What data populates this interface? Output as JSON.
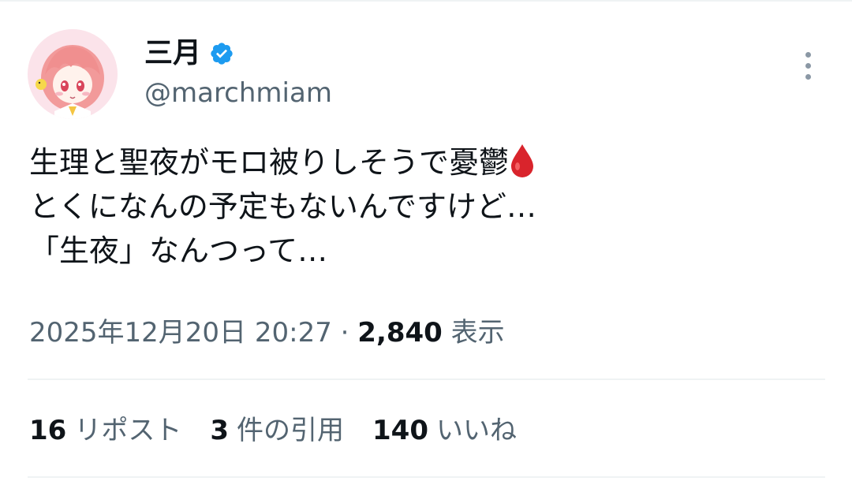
{
  "author": {
    "display_name": "三月",
    "handle": "@marchmiam",
    "verified_icon": "verified-badge-icon",
    "avatar_icon": "avatar-image"
  },
  "tweet": {
    "line1": "生理と聖夜がモロ被りしそうで憂鬱",
    "line1_emoji": "drop-of-blood-icon",
    "line2": "とくになんの予定もないんですけど…",
    "line3": "「生夜」なんつって…"
  },
  "meta": {
    "timestamp": "2025年12月20日 20:27",
    "separator": "·",
    "views_count": "2,840",
    "views_label": "表示"
  },
  "stats": {
    "reposts_count": "16",
    "reposts_label": "リポスト",
    "quotes_count": "3",
    "quotes_label": "件の引用",
    "likes_count": "140",
    "likes_label": "いいね"
  },
  "colors": {
    "primary_text": "#0f1419",
    "secondary_text": "#536471",
    "verified_blue": "#1d9bf0",
    "divider": "#eff3f4"
  }
}
